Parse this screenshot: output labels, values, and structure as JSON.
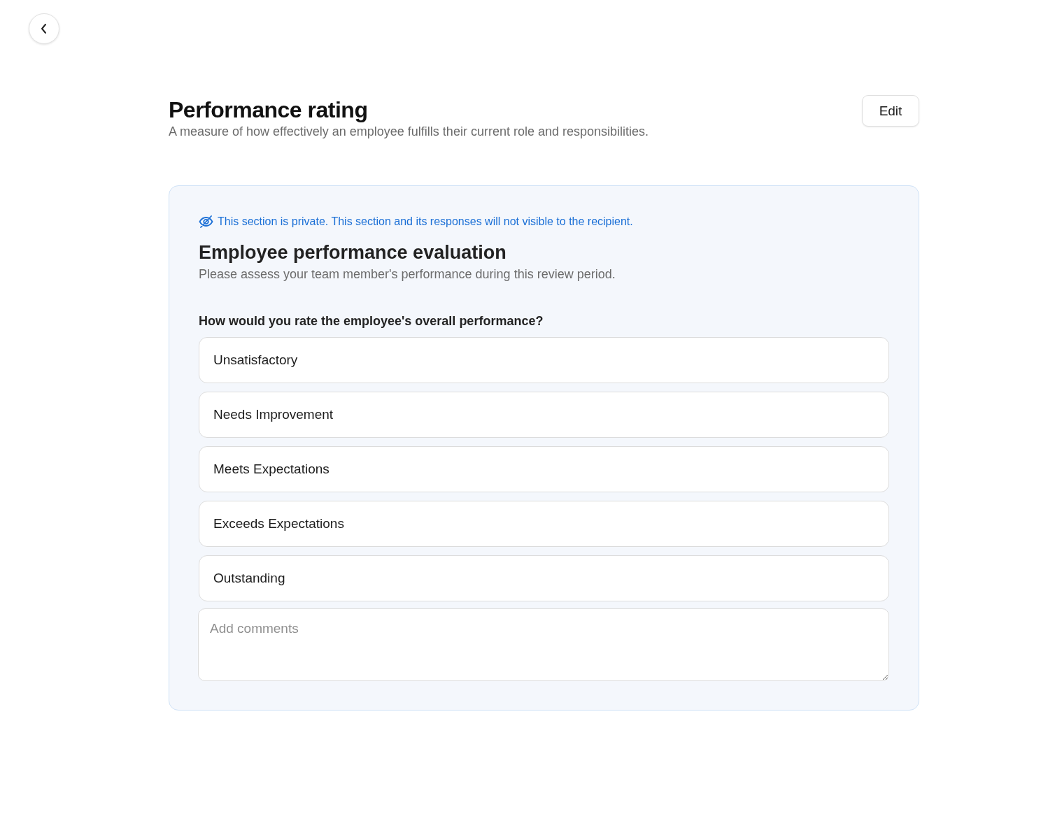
{
  "header": {
    "title": "Performance rating",
    "description": "A measure of how effectively an employee fulfills their current role and responsibilities.",
    "edit_button": "Edit"
  },
  "section": {
    "private_notice": "This section is private. This section and its responses will not visible to the recipient.",
    "title": "Employee performance evaluation",
    "description": "Please assess your team member's performance during this review period.",
    "question": "How would you rate the employee's overall performance?",
    "options": [
      {
        "label": "Unsatisfactory",
        "selected": false
      },
      {
        "label": "Needs Improvement",
        "selected": false
      },
      {
        "label": "Meets Expectations",
        "selected": false
      },
      {
        "label": "Exceeds Expectations",
        "selected": false
      },
      {
        "label": "Outstanding",
        "selected": false
      }
    ],
    "comments": {
      "placeholder": "Add comments"
    }
  }
}
